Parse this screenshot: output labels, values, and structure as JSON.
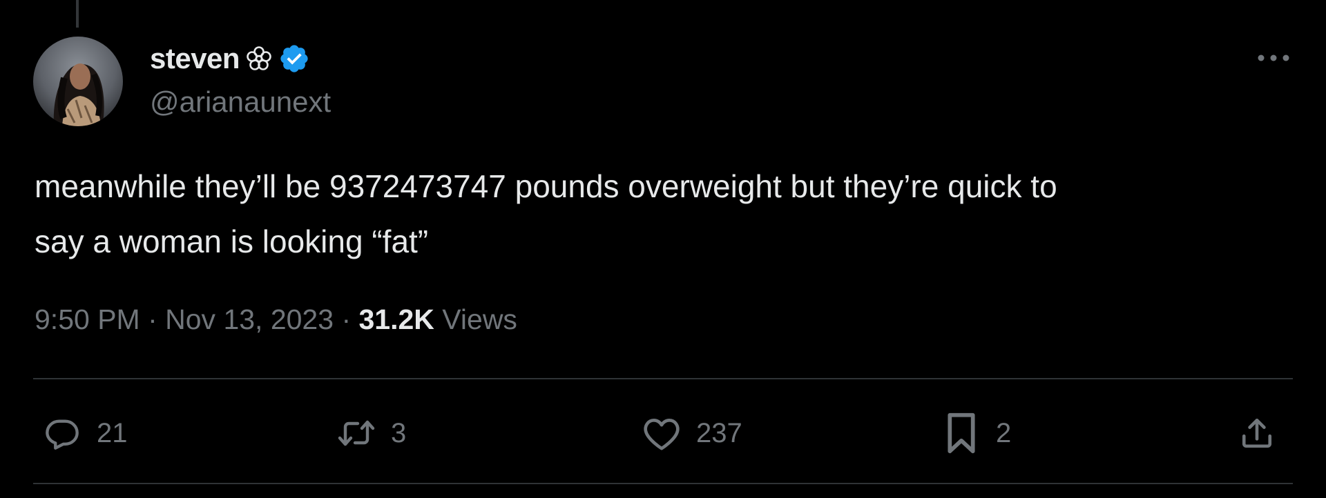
{
  "tweet": {
    "author": {
      "display_name": "steven",
      "handle": "@arianaunext",
      "flower_icon": "flower-emoji-icon",
      "verified_icon": "verified-badge-icon",
      "verified_color": "#1d9bf0"
    },
    "text": "meanwhile they’ll be 9372473747 pounds overweight but they’re quick to\nsay a woman is looking “fat”",
    "time": "9:50 PM",
    "separator": " · ",
    "date": "Nov 13, 2023",
    "views_count": "31.2K",
    "views_label": " Views"
  },
  "actions": {
    "reply_count": "21",
    "retweet_count": "3",
    "like_count": "237",
    "bookmark_count": "2"
  },
  "icons": {
    "more": "more-options-icon",
    "reply": "reply-icon",
    "retweet": "retweet-icon",
    "like": "heart-icon",
    "bookmark": "bookmark-icon",
    "share": "share-icon"
  },
  "colors": {
    "background": "#000000",
    "text_primary": "#e7e9ea",
    "text_secondary": "#71767b",
    "divider": "#2f3336"
  }
}
